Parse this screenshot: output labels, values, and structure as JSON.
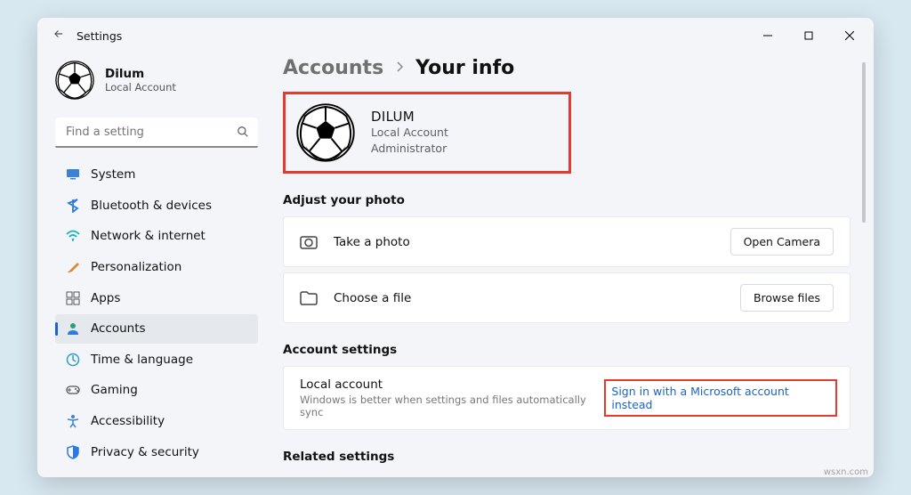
{
  "window": {
    "title": "Settings"
  },
  "profile": {
    "name": "Dilum",
    "subtitle": "Local Account"
  },
  "search": {
    "placeholder": "Find a setting"
  },
  "nav": [
    {
      "label": "System"
    },
    {
      "label": "Bluetooth & devices"
    },
    {
      "label": "Network & internet"
    },
    {
      "label": "Personalization"
    },
    {
      "label": "Apps"
    },
    {
      "label": "Accounts"
    },
    {
      "label": "Time & language"
    },
    {
      "label": "Gaming"
    },
    {
      "label": "Accessibility"
    },
    {
      "label": "Privacy & security"
    }
  ],
  "breadcrumb": {
    "parent": "Accounts",
    "current": "Your info"
  },
  "hero": {
    "name": "DILUM",
    "line1": "Local Account",
    "line2": "Administrator"
  },
  "sections": {
    "photo": {
      "heading": "Adjust your photo",
      "take": {
        "label": "Take a photo",
        "button": "Open Camera"
      },
      "choose": {
        "label": "Choose a file",
        "button": "Browse files"
      }
    },
    "account": {
      "heading": "Account settings",
      "local": {
        "title": "Local account",
        "desc": "Windows is better when settings and files automatically sync",
        "action": "Sign in with a Microsoft account instead"
      }
    },
    "related": {
      "heading": "Related settings"
    }
  },
  "watermark": "wsxn.com"
}
